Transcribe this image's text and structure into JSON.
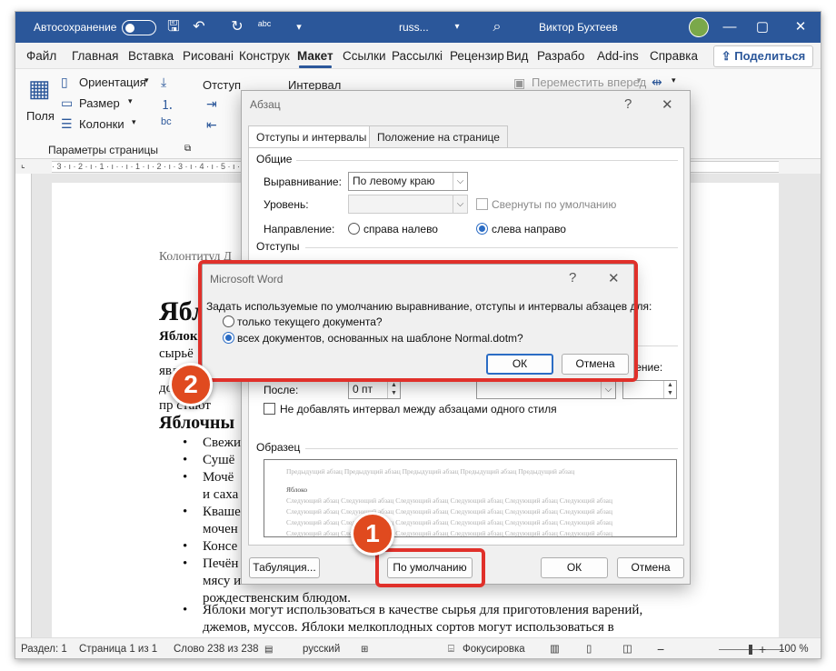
{
  "titlebar": {
    "autosave_label": "Автосохранение",
    "doc_name": "russ...",
    "user_name": "Виктор Бухтеев",
    "search_icon": "search-icon",
    "save_icon": "save-icon",
    "undo_icon": "undo-icon",
    "redo_icon": "redo-icon",
    "spellcheck_label": "abc",
    "minimize": "—",
    "restore": "▢",
    "close": "✕"
  },
  "ribbon_tabs": [
    "Файл",
    "Главная",
    "Вставка",
    "Рисовані",
    "Конструк",
    "Макет",
    "Ссылки",
    "Рассылкі",
    "Рецензир",
    "Вид",
    "Разрабо",
    "Add-ins",
    "Справка"
  ],
  "active_tab": "Макет",
  "share_label": "Поделиться",
  "ribbon": {
    "margins_label": "Поля",
    "orientation_label": "Ориентация",
    "size_label": "Размер",
    "columns_label": "Колонки",
    "group_label": "Параметры страницы",
    "indent_label": "Отступ",
    "spacing_label": "Интервал",
    "bring_forward_label": "Переместить вперед",
    "hyphen_label": "bc"
  },
  "ruler": "· 3 · ı · 2 · ı · 1 · ı ·   · ı · 1 · ı · 2 · ı · 3 · ı · 4 · ı · 5 · ı · 6 · ı · 7 · ı · 8 · ı · 9 · ı · 10 · ı · 11 · ı · 12 · ı · 13 · ı · 14 · ı · 15 · ı · 16 · ı · 17 · ı · 18 ·",
  "document": {
    "header": "Колонтитул Д",
    "title_partial": "Ябл",
    "line1": "Яблок",
    "line2": "сырьё",
    "line3": "являет",
    "line4": "до",
    "line5": "пр   стают",
    "heading2": "Яблочны",
    "bullets": [
      "Свежи",
      "Сушё",
      "Мочё",
      "и саха",
      "Кваше",
      "мочен",
      "Консе",
      "Печён",
      "мясу и",
      "рождественским блюдом."
    ],
    "bullet_last_1": "Яблоки могут использоваться в качестве сырья для приготовления варений,",
    "bullet_last_2": "джемов, муссов. Яблоки мелкоплодных сортов могут использоваться в"
  },
  "status": {
    "section": "Раздел: 1",
    "page": "Страница 1 из 1",
    "words": "Слово 238 из 238",
    "language": "русский",
    "focus": "Фокусировка",
    "zoom": "100 %",
    "zoom_out": "−",
    "zoom_in": "+"
  },
  "paragraph_dialog": {
    "title": "Абзац",
    "help": "?",
    "close": "✕",
    "tab_indents": "Отступы и интервалы",
    "tab_position": "Положение на странице",
    "general_section": "Общие",
    "alignment_label": "Выравнивание:",
    "alignment_value": "По левому краю",
    "level_label": "Уровень:",
    "level_value": "",
    "collapsed_label": "Свернуты по умолчанию",
    "direction_label": "Направление:",
    "rtl_label": "справа налево",
    "ltr_label": "слева направо",
    "direction_selected": "ltr",
    "indents_section": "Отступы",
    "value_label_partial": "чение:",
    "after_label": "После:",
    "after_value": "0 пт",
    "no_space_label": "Не добавлять интервал между абзацами одного стиля",
    "preview_section": "Образец",
    "preview_prev": "Предыдущий абзац Предыдущий абзац Предыдущий абзац Предыдущий абзац Предыдущий абзац",
    "preview_current": "Яблоко",
    "preview_next": "Следующий абзац Следующий абзац Следующий абзац Следующий абзац Следующий абзац Следующий абзац",
    "tabs_button": "Табуляция...",
    "default_button": "По умолчанию",
    "ok_button": "ОК",
    "cancel_button": "Отмена"
  },
  "message_box": {
    "title": "Microsoft Word",
    "help": "?",
    "close": "✕",
    "question": "Задать используемые по умолчанию выравнивание, отступы и интервалы абзацев для:",
    "option_current": "только текущего документа?",
    "option_all": "всех документов, основанных на шаблоне Normal.dotm?",
    "selected": "all",
    "ok_button": "ОК",
    "cancel_button": "Отмена"
  },
  "annotations": {
    "badge1": "1",
    "badge2": "2",
    "highlight_color": "#e0302a",
    "badge_color": "#e04a1f"
  },
  "colors": {
    "titlebar": "#2b579a",
    "accent": "#2b6cc4"
  }
}
